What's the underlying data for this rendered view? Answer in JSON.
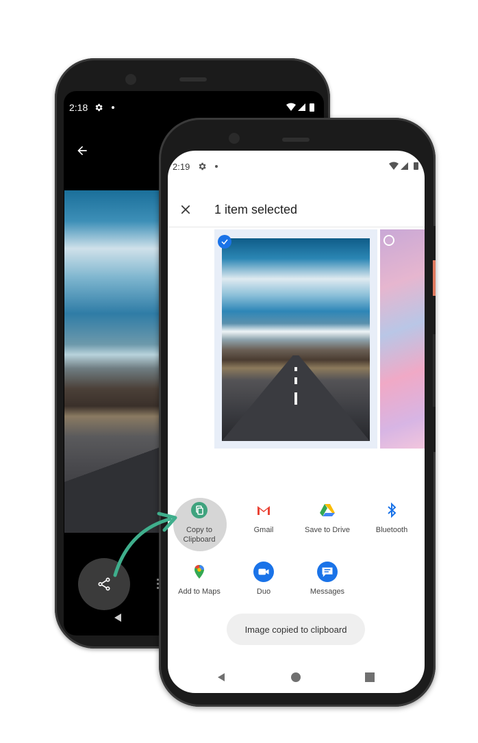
{
  "back_phone": {
    "status_time": "2:18"
  },
  "front_phone": {
    "status_time": "2:19",
    "header": {
      "title": "1 item selected"
    },
    "share_targets": [
      {
        "label_line1": "Copy to",
        "label_line2": "Clipboard",
        "icon": "copy-icon",
        "color": "#3fa37e"
      },
      {
        "label": "Gmail",
        "icon": "gmail-icon",
        "color": "#ea4335"
      },
      {
        "label": "Save to Drive",
        "icon": "drive-icon",
        "color": "#34a853"
      },
      {
        "label": "Bluetooth",
        "icon": "bluetooth-icon",
        "color": "#1a73e8"
      },
      {
        "label": "Add to Maps",
        "icon": "maps-pin-icon",
        "color": "#ea4335"
      },
      {
        "label": "Duo",
        "icon": "duo-icon",
        "color": "#1a73e8"
      },
      {
        "label": "Messages",
        "icon": "messages-icon",
        "color": "#1a73e8"
      }
    ],
    "snackbar": "Image copied to clipboard"
  },
  "colors": {
    "accent_blue": "#1a73e8",
    "arrow_green": "#3fae8c"
  }
}
